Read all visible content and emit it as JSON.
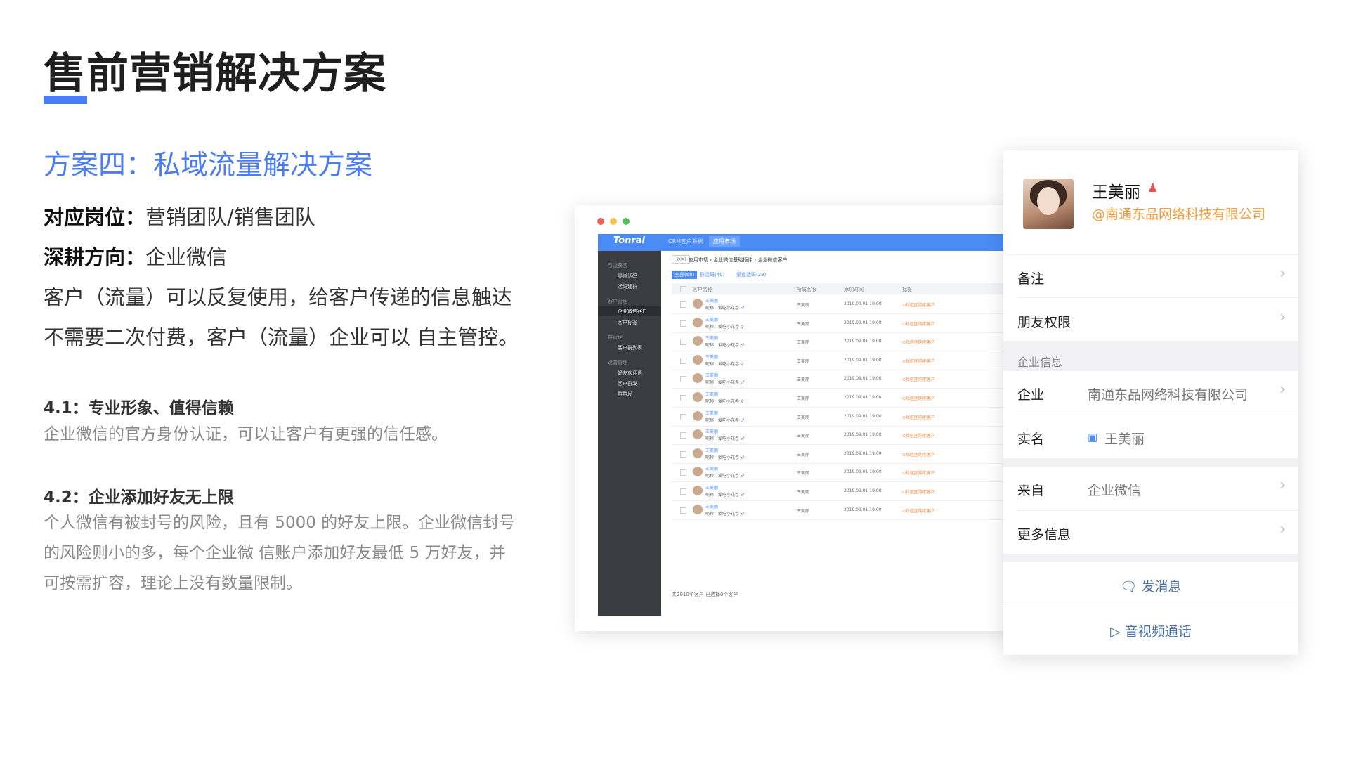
{
  "title": "售前营销解决方案",
  "subtitle": "方案四：私域流量解决方案",
  "lines": {
    "post_label": "对应岗位：",
    "post_value": "营销团队/销售团队",
    "dir_label": "深耕方向：",
    "dir_value": "企业微信",
    "desc1": "客户（流量）可以反复使用，给客户传递的信息触达",
    "desc2": "不需要二次付费，客户（流量）企业可以 自主管控。"
  },
  "sections": [
    {
      "heading": "4.1：专业形象、值得信赖",
      "text": [
        "企业微信的官方身份认证，可以让客户有更强的信任感。"
      ]
    },
    {
      "heading": "4.2：企业添加好友无上限",
      "text": [
        "个人微信有被封号的风险，且有 5000 的好友上限。企业微信封号",
        "的风险则小的多，每个企业微 信账户添加好友最低 5 万好友，并",
        "可按需扩容，理论上没有数量限制。"
      ]
    }
  ],
  "crm": {
    "logo": "Tonrai",
    "top_tabs": [
      "CRM客户系统",
      "应用市场"
    ],
    "sidebar": [
      {
        "type": "group",
        "label": "引流获客"
      },
      {
        "type": "item",
        "label": "渠道活码"
      },
      {
        "type": "item",
        "label": "活码建群"
      },
      {
        "type": "group",
        "label": "客户管理"
      },
      {
        "type": "item",
        "label": "企业微信客户",
        "active": true
      },
      {
        "type": "item",
        "label": "客户标签"
      },
      {
        "type": "group",
        "label": "群管理"
      },
      {
        "type": "item",
        "label": "客户群列表"
      },
      {
        "type": "group",
        "label": "运营管理"
      },
      {
        "type": "item",
        "label": "好友欢迎语"
      },
      {
        "type": "item",
        "label": "客户群发"
      },
      {
        "type": "item",
        "label": "群群发"
      }
    ],
    "back": "返回",
    "breadcrumb": [
      "应用市场",
      "企业微信基础插件",
      "企业微信客户"
    ],
    "filters": [
      {
        "label": "全部(68)",
        "active": true
      },
      {
        "label": "群活码(40)"
      },
      {
        "label": "渠道活码(28)"
      }
    ],
    "columns": [
      "客户名称",
      "所属客服",
      "添加时间",
      "标签"
    ],
    "rows": [
      {
        "name": "王美丽",
        "sub": "昵称：爱吃小花卷",
        "staff": "王美丽",
        "time": "2019.09.01 19:00",
        "tag": "社区团购老客户",
        "gender": "m"
      },
      {
        "name": "王美丽",
        "sub": "昵称：爱吃小花卷",
        "staff": "王美丽",
        "time": "2019.09.01 19:00",
        "tag": "社区团购老客户",
        "gender": "f"
      },
      {
        "name": "王美丽",
        "sub": "昵称：爱吃小花卷",
        "staff": "王美丽",
        "time": "2019.09.01 19:00",
        "tag": "社区团购老客户",
        "gender": "m"
      },
      {
        "name": "王美丽",
        "sub": "昵称：爱吃小花卷",
        "staff": "王美丽",
        "time": "2019.09.01 19:00",
        "tag": "社区团购老客户",
        "gender": "f"
      },
      {
        "name": "王美丽",
        "sub": "昵称：爱吃小花卷",
        "staff": "王美丽",
        "time": "2019.09.01 19:00",
        "tag": "社区团购老客户",
        "gender": "m"
      },
      {
        "name": "王美丽",
        "sub": "昵称：爱吃小花卷",
        "staff": "王美丽",
        "time": "2019.09.01 19:00",
        "tag": "社区团购老客户",
        "gender": "f"
      },
      {
        "name": "王美丽",
        "sub": "昵称：爱吃小花卷",
        "staff": "王美丽",
        "time": "2019.09.01 19:00",
        "tag": "社区团购老客户",
        "gender": "m"
      },
      {
        "name": "王美丽",
        "sub": "昵称：爱吃小花卷",
        "staff": "王美丽",
        "time": "2019.09.01 19:00",
        "tag": "社区团购老客户",
        "gender": "m"
      },
      {
        "name": "王美丽",
        "sub": "昵称：爱吃小花卷",
        "staff": "王美丽",
        "time": "2019.09.01 19:00",
        "tag": "社区团购老客户",
        "gender": "m"
      },
      {
        "name": "王美丽",
        "sub": "昵称：爱吃小花卷",
        "staff": "王美丽",
        "time": "2019.09.01 19:00",
        "tag": "社区团购老客户",
        "gender": "m"
      },
      {
        "name": "王美丽",
        "sub": "昵称：爱吃小花卷",
        "staff": "王美丽",
        "time": "2019.09.01 19:00",
        "tag": "社区团购老客户",
        "gender": "m"
      },
      {
        "name": "王美丽",
        "sub": "昵称：爱吃小花卷",
        "staff": "王美丽",
        "time": "2019.09.01 19:00",
        "tag": "社区团购老客户",
        "gender": "m"
      }
    ],
    "total": "共2910个客户    已选择0个客户"
  },
  "profile": {
    "name": "王美丽",
    "company": "@南通东品网络科技有限公司",
    "remark": "备注",
    "friend_perm": "朋友权限",
    "group_title": "企业信息",
    "corp_label": "企业",
    "corp_value": "南通东品网络科技有限公司",
    "realname_label": "实名",
    "realname_value": "王美丽",
    "from_label": "来自",
    "from_value": "企业微信",
    "more": "更多信息",
    "send_msg": "发消息",
    "av_call": "音视频通话"
  },
  "colors": {
    "accent": "#4a7cf4",
    "orange": "#f29b3c"
  }
}
